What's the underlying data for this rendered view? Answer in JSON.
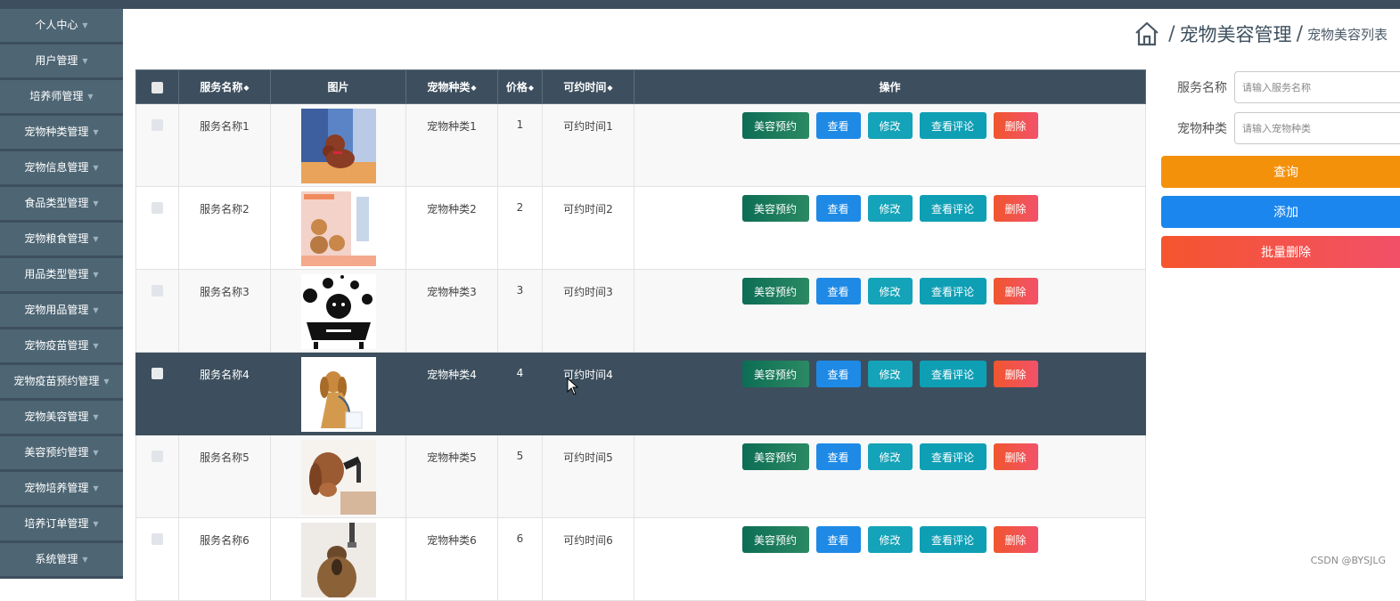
{
  "sidebar": {
    "items": [
      {
        "label": "个人中心"
      },
      {
        "label": "用户管理"
      },
      {
        "label": "培养师管理"
      },
      {
        "label": "宠物种类管理"
      },
      {
        "label": "宠物信息管理"
      },
      {
        "label": "食品类型管理"
      },
      {
        "label": "宠物粮食管理"
      },
      {
        "label": "用品类型管理"
      },
      {
        "label": "宠物用品管理"
      },
      {
        "label": "宠物疫苗管理"
      },
      {
        "label": "宠物疫苗预约管理"
      },
      {
        "label": "宠物美容管理"
      },
      {
        "label": "美容预约管理"
      },
      {
        "label": "宠物培养管理"
      },
      {
        "label": "培养订单管理"
      },
      {
        "label": "系统管理"
      }
    ]
  },
  "breadcrumb": {
    "sep1": "/",
    "main": "宠物美容管理",
    "sep2": "/",
    "sub": "宠物美容列表"
  },
  "table": {
    "headers": {
      "name": "服务名称",
      "image": "图片",
      "species": "宠物种类",
      "price": "价格",
      "time": "可约时间",
      "ops": "操作"
    },
    "rows": [
      {
        "name": "服务名称1",
        "species": "宠物种类1",
        "price": "1",
        "time": "可约时间1"
      },
      {
        "name": "服务名称2",
        "species": "宠物种类2",
        "price": "2",
        "time": "可约时间2"
      },
      {
        "name": "服务名称3",
        "species": "宠物种类3",
        "price": "3",
        "time": "可约时间3"
      },
      {
        "name": "服务名称4",
        "species": "宠物种类4",
        "price": "4",
        "time": "可约时间4"
      },
      {
        "name": "服务名称5",
        "species": "宠物种类5",
        "price": "5",
        "time": "可约时间5"
      },
      {
        "name": "服务名称6",
        "species": "宠物种类6",
        "price": "6",
        "time": "可约时间6"
      }
    ],
    "actions": {
      "book": "美容预约",
      "view": "查看",
      "edit": "修改",
      "review": "查看评论",
      "delete": "删除"
    }
  },
  "search": {
    "name_label": "服务名称",
    "name_placeholder": "请输入服务名称",
    "species_label": "宠物种类",
    "species_placeholder": "请输入宠物种类",
    "query_label": "查询",
    "add_label": "添加",
    "batch_delete_label": "批量删除"
  },
  "watermark": "CSDN @BYSJLG",
  "colors": {
    "sidebar_bg": "#3d4f5e",
    "sidebar_item": "#4e6674",
    "header_bg": "#3d4f5e",
    "query": "#f4910a",
    "add": "#1a86ee",
    "delete": "#f5552d"
  }
}
